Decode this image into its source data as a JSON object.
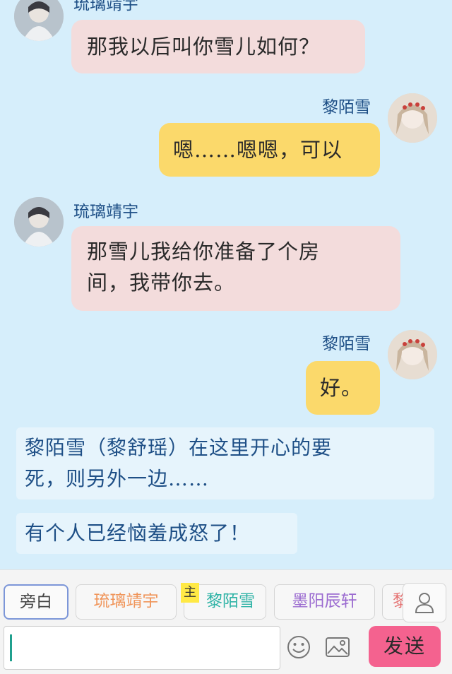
{
  "messages": [
    {
      "side": "left",
      "name": "琉璃靖宇",
      "text": "那我以后叫你雪儿如何？"
    },
    {
      "side": "right",
      "name": "黎陌雪",
      "text": "嗯……嗯嗯，可以"
    },
    {
      "side": "left",
      "name": "琉璃靖宇",
      "lines": [
        "那雪儿我给你准备了个房",
        "间，我带你去。"
      ]
    },
    {
      "side": "right",
      "name": "黎陌雪",
      "text": "好。"
    }
  ],
  "narrations": [
    {
      "lines": [
        "黎陌雪（黎舒瑶）在这里开心的要",
        "死，则另外一边……"
      ]
    },
    {
      "lines": [
        "有个人已经恼羞成怒了！"
      ]
    }
  ],
  "roles": [
    {
      "label": "旁白",
      "color": "#444444",
      "selected": true
    },
    {
      "label": "琉璃靖宇",
      "color": "#f0955a"
    },
    {
      "label": "黎陌雪",
      "color": "#2fb3a6",
      "badge": "主"
    },
    {
      "label": "墨阳辰轩",
      "color": "#9b6bd0"
    },
    {
      "label": "黎",
      "color": "#e57373"
    }
  ],
  "input": {
    "value": "",
    "placeholder": ""
  },
  "send_label": "发送",
  "icons": [
    "user-icon",
    "emoji-icon",
    "image-icon"
  ]
}
